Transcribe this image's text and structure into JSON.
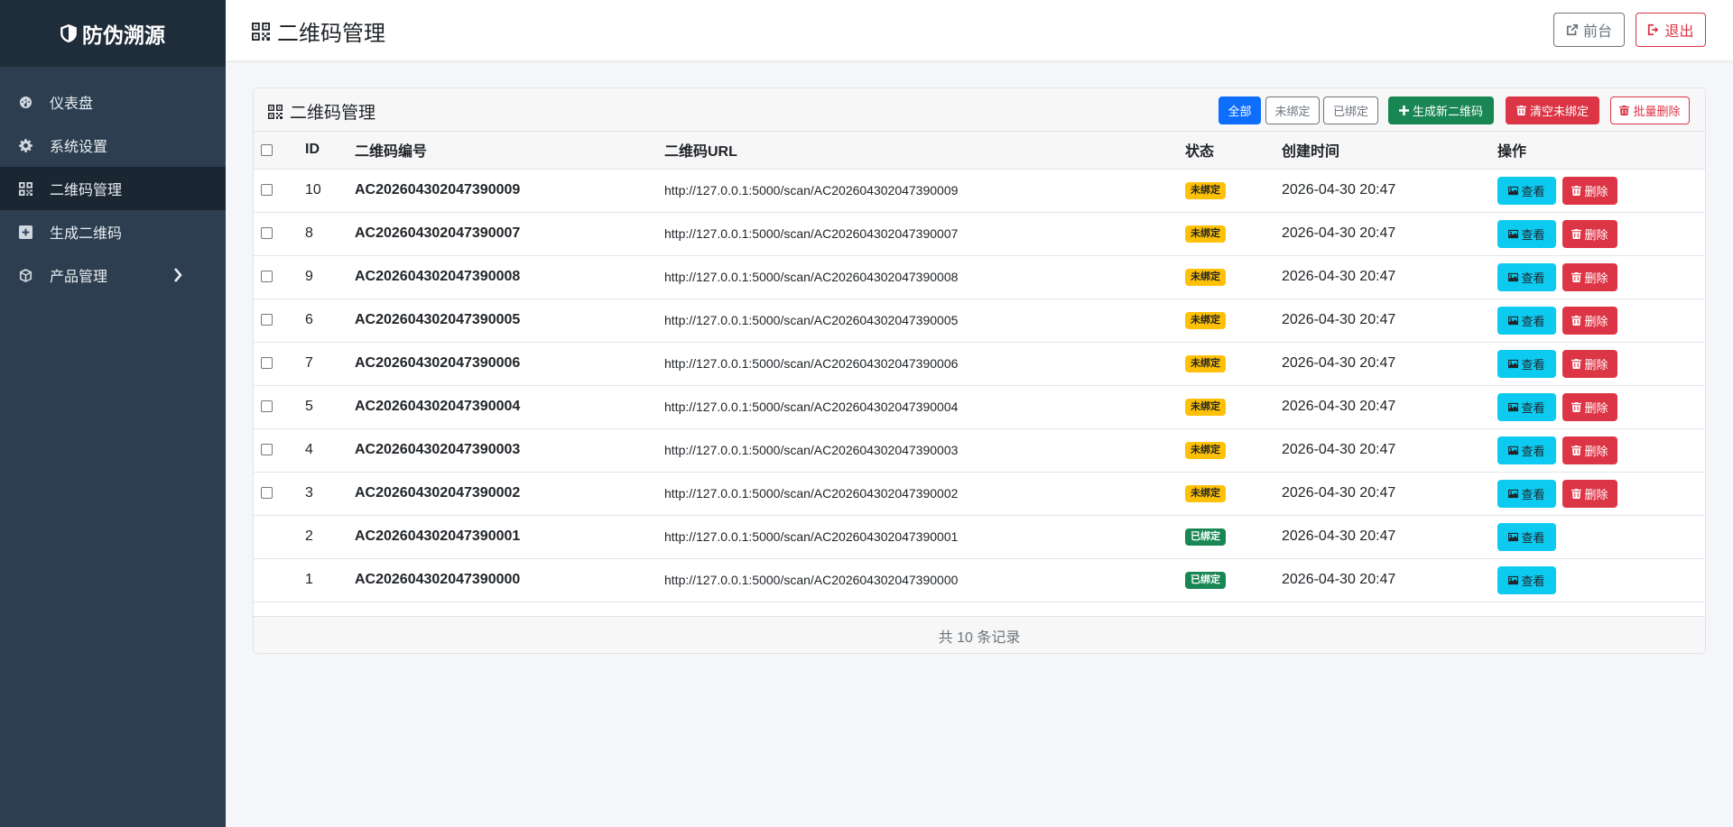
{
  "sidebar": {
    "brand": "防伪溯源",
    "items": [
      {
        "label": "仪表盘",
        "icon": "dashboard-icon"
      },
      {
        "label": "系统设置",
        "icon": "gear-icon"
      },
      {
        "label": "二维码管理",
        "icon": "qrcode-icon",
        "active": true
      },
      {
        "label": "生成二维码",
        "icon": "plus-square-icon"
      },
      {
        "label": "产品管理",
        "icon": "box-icon",
        "expandable": true
      }
    ]
  },
  "header": {
    "title": "二维码管理",
    "front_label": "前台",
    "logout_label": "退出"
  },
  "card": {
    "title": "二维码管理",
    "filters": {
      "all": "全部",
      "unbound": "未绑定",
      "bound": "已绑定"
    },
    "generate_label": "生成新二维码",
    "clear_label": "清空未绑定",
    "batch_delete_label": "批量删除",
    "columns": [
      "ID",
      "二维码编号",
      "二维码URL",
      "状态",
      "创建时间",
      "操作"
    ],
    "view_label": "查看",
    "delete_label": "删除",
    "rows": [
      {
        "id": "10",
        "code": "AC202604302047390009",
        "url": "http://127.0.0.1:5000/scan/AC202604302047390009",
        "status": "未绑定",
        "bound": false,
        "time": "2026-04-30 20:47"
      },
      {
        "id": "8",
        "code": "AC202604302047390007",
        "url": "http://127.0.0.1:5000/scan/AC202604302047390007",
        "status": "未绑定",
        "bound": false,
        "time": "2026-04-30 20:47"
      },
      {
        "id": "9",
        "code": "AC202604302047390008",
        "url": "http://127.0.0.1:5000/scan/AC202604302047390008",
        "status": "未绑定",
        "bound": false,
        "time": "2026-04-30 20:47"
      },
      {
        "id": "6",
        "code": "AC202604302047390005",
        "url": "http://127.0.0.1:5000/scan/AC202604302047390005",
        "status": "未绑定",
        "bound": false,
        "time": "2026-04-30 20:47"
      },
      {
        "id": "7",
        "code": "AC202604302047390006",
        "url": "http://127.0.0.1:5000/scan/AC202604302047390006",
        "status": "未绑定",
        "bound": false,
        "time": "2026-04-30 20:47"
      },
      {
        "id": "5",
        "code": "AC202604302047390004",
        "url": "http://127.0.0.1:5000/scan/AC202604302047390004",
        "status": "未绑定",
        "bound": false,
        "time": "2026-04-30 20:47"
      },
      {
        "id": "4",
        "code": "AC202604302047390003",
        "url": "http://127.0.0.1:5000/scan/AC202604302047390003",
        "status": "未绑定",
        "bound": false,
        "time": "2026-04-30 20:47"
      },
      {
        "id": "3",
        "code": "AC202604302047390002",
        "url": "http://127.0.0.1:5000/scan/AC202604302047390002",
        "status": "未绑定",
        "bound": false,
        "time": "2026-04-30 20:47"
      },
      {
        "id": "2",
        "code": "AC202604302047390001",
        "url": "http://127.0.0.1:5000/scan/AC202604302047390001",
        "status": "已绑定",
        "bound": true,
        "time": "2026-04-30 20:47"
      },
      {
        "id": "1",
        "code": "AC202604302047390000",
        "url": "http://127.0.0.1:5000/scan/AC202604302047390000",
        "status": "已绑定",
        "bound": true,
        "time": "2026-04-30 20:47"
      }
    ],
    "footer": "共 10 条记录"
  },
  "colors": {
    "sidebar_bg": "#2c3e50",
    "primary": "#0d6efd",
    "success": "#198754",
    "danger": "#dc3545",
    "info": "#0dcaf0",
    "warning": "#ffc107"
  }
}
